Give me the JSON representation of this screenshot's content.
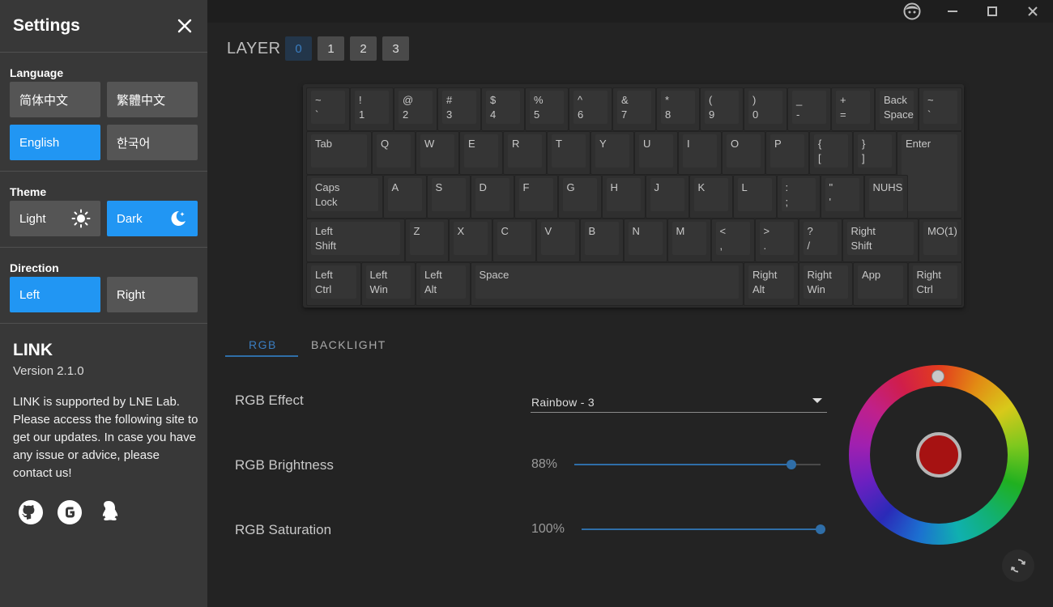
{
  "window": {
    "icons": [
      "face-icon",
      "minimize-icon",
      "maximize-icon",
      "close-icon"
    ]
  },
  "sidebar": {
    "title": "Settings",
    "language": {
      "label": "Language",
      "options": [
        "简体中文",
        "繁體中文",
        "English",
        "한국어"
      ],
      "selected": "English"
    },
    "theme": {
      "label": "Theme",
      "options": [
        "Light",
        "Dark"
      ],
      "selected": "Dark"
    },
    "direction": {
      "label": "Direction",
      "options": [
        "Left",
        "Right"
      ],
      "selected": "Left"
    },
    "about": {
      "title": "LINK",
      "version": "Version 2.1.0",
      "text": "LINK is supported by LNE Lab. Please access the following site to get our updates. In case you have any issue or advice, please contact us!",
      "links": [
        "github-icon",
        "g-icon",
        "qq-icon"
      ]
    }
  },
  "layer": {
    "label": "LAYER",
    "buttons": [
      "0",
      "1",
      "2",
      "3"
    ],
    "selected": "0"
  },
  "keyboard": {
    "rows": [
      [
        [
          "~\n`"
        ],
        [
          "!\n1"
        ],
        [
          "@\n2"
        ],
        [
          "#\n3"
        ],
        [
          "$\n4"
        ],
        [
          "%\n5"
        ],
        [
          "^\n6"
        ],
        [
          "&\n7"
        ],
        [
          "*\n8"
        ],
        [
          "(\n9"
        ],
        [
          ")\n0"
        ],
        [
          "_\n-"
        ],
        [
          "+\n="
        ],
        [
          "Back\nSpace"
        ],
        [
          "~\n`"
        ]
      ],
      [
        [
          "Tab"
        ],
        [
          "Q"
        ],
        [
          "W"
        ],
        [
          "E"
        ],
        [
          "R"
        ],
        [
          "T"
        ],
        [
          "Y"
        ],
        [
          "U"
        ],
        [
          "I"
        ],
        [
          "O"
        ],
        [
          "P"
        ],
        [
          "{\n["
        ],
        [
          "}\n]"
        ],
        [
          "Enter"
        ]
      ],
      [
        [
          "Caps\nLock"
        ],
        [
          "A"
        ],
        [
          "S"
        ],
        [
          "D"
        ],
        [
          "F"
        ],
        [
          "G"
        ],
        [
          "H"
        ],
        [
          "J"
        ],
        [
          "K"
        ],
        [
          "L"
        ],
        [
          ":\n;"
        ],
        [
          "\"\n'"
        ],
        [
          "NUHS"
        ]
      ],
      [
        [
          "Left\nShift"
        ],
        [
          "Z"
        ],
        [
          "X"
        ],
        [
          "C"
        ],
        [
          "V"
        ],
        [
          "B"
        ],
        [
          "N"
        ],
        [
          "M"
        ],
        [
          "<\n,"
        ],
        [
          ">\n."
        ],
        [
          "?\n/"
        ],
        [
          "Right\nShift"
        ],
        [
          "MO(1)"
        ]
      ],
      [
        [
          "Left\nCtrl"
        ],
        [
          "Left\nWin"
        ],
        [
          "Left\nAlt"
        ],
        [
          "Space"
        ],
        [
          "Right\nAlt"
        ],
        [
          "Right\nWin"
        ],
        [
          "App"
        ],
        [
          "Right\nCtrl"
        ]
      ]
    ]
  },
  "tabs": {
    "items": [
      "RGB",
      "BACKLIGHT"
    ],
    "selected": "RGB"
  },
  "rgb": {
    "effect_label": "RGB Effect",
    "effect_value": "Rainbow - 3",
    "brightness_label": "RGB Brightness",
    "brightness_value": "88%",
    "brightness": 0.88,
    "saturation_label": "RGB Saturation",
    "saturation_value": "100%",
    "saturation": 1.0,
    "selected_color": "#a61212"
  },
  "colors": {
    "accent": "#2196f3",
    "slider": "#2f6ea8"
  }
}
